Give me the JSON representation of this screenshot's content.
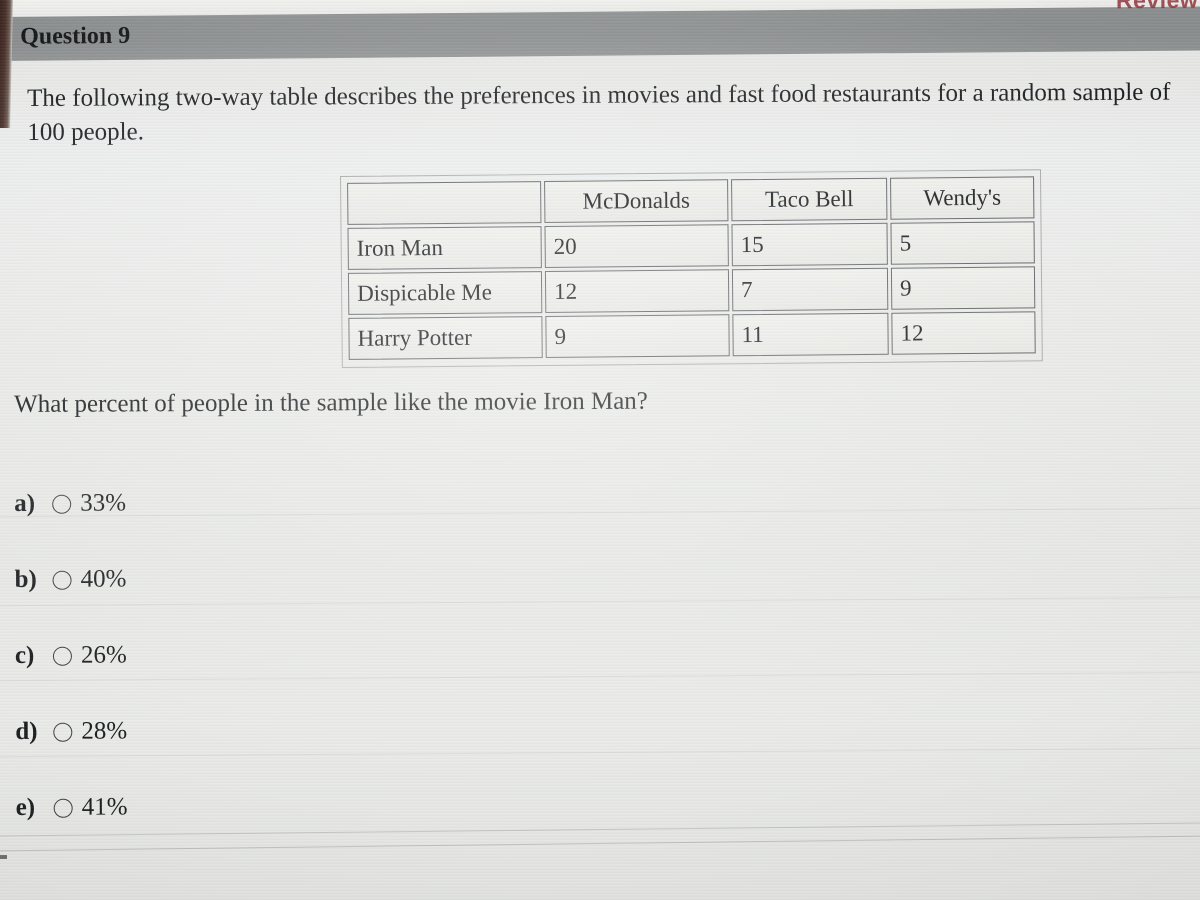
{
  "page": {
    "question_header": "Question 9",
    "review_label": "Review",
    "stem": "The following two-way table describes the preferences in movies and fast food restaurants for a random sample of 100 people.",
    "subquestion": "What percent of people in the sample like the movie Iron Man?"
  },
  "table": {
    "corner_label": "",
    "columns": [
      "McDonalds",
      "Taco Bell",
      "Wendy's"
    ],
    "rows": [
      {
        "label": "Iron Man",
        "values": [
          "20",
          "15",
          "5"
        ]
      },
      {
        "label": "Dispicable Me",
        "values": [
          "12",
          "7",
          "9"
        ]
      },
      {
        "label": "Harry Potter",
        "values": [
          "9",
          "11",
          "12"
        ]
      }
    ]
  },
  "options": [
    {
      "letter": "a)",
      "text": "33%"
    },
    {
      "letter": "b)",
      "text": "40%"
    },
    {
      "letter": "c)",
      "text": "26%"
    },
    {
      "letter": "d)",
      "text": "28%"
    },
    {
      "letter": "e)",
      "text": "41%"
    }
  ],
  "colors": {
    "header_bar": "#8a8d8e",
    "page_background": "#e9eae6",
    "text": "#1b1d20",
    "review_red": "#8f2d33",
    "cell_border": "#5d5f61"
  }
}
